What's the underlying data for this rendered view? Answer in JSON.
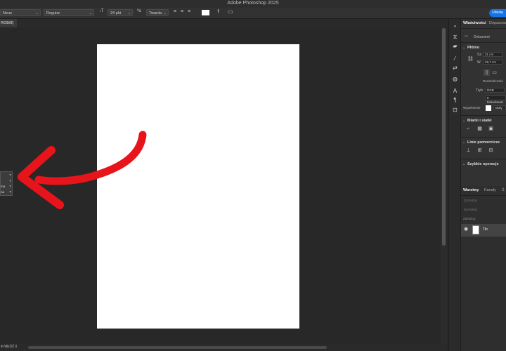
{
  "window": {
    "title": "Adobe Photoshop 2025"
  },
  "options_bar": {
    "font_family": "Neue",
    "font_style": "Regular",
    "font_size": "24 pkt",
    "anti_alias": "Twarda",
    "share_label": "Udostę"
  },
  "document_tab": {
    "label": "RGB/8)"
  },
  "status": {
    "text": "4 NIEDŹ 0"
  },
  "popup": {
    "rows": [
      {
        "label": "",
        "glyph": "T"
      },
      {
        "label": "",
        "glyph": "T"
      },
      {
        "label": "ma",
        "glyph": "T"
      },
      {
        "label": "na",
        "glyph": "T"
      }
    ]
  },
  "panel": {
    "tabs": {
      "properties": "Właściwości",
      "adjustments": "Dopasowa"
    },
    "doc_label": "Dokument",
    "canvas": {
      "heading": "Płótno",
      "w_label": "Sz",
      "w_value": "21 cm",
      "h_label": "W",
      "h_value": "29,7 cm",
      "orientation_label": "Rozdzielczość",
      "mode_label": "Tryb",
      "mode_value": "RGB",
      "depth_value": "8 bitów/kanał",
      "fill_label": "Wypełnienie",
      "fill_value": "Biały"
    },
    "sections": {
      "rulers": "Miarki i siatki",
      "guides": "Linie pomocnicze",
      "quick_actions": "Szybkie operacje"
    }
  },
  "layers_panel": {
    "tabs": {
      "layers": "Warstwy",
      "channels": "Kanały",
      "paths": "Ś"
    },
    "search_placeholder": "Q Rodzaj",
    "blend_mode": "Normalny",
    "lock_label": "Zablokuj:",
    "layer_name": "Tło"
  },
  "colors": {
    "accent": "#1473e6",
    "arrow": "#e8141b",
    "canvas": "#ffffff",
    "workspace": "#282828"
  }
}
